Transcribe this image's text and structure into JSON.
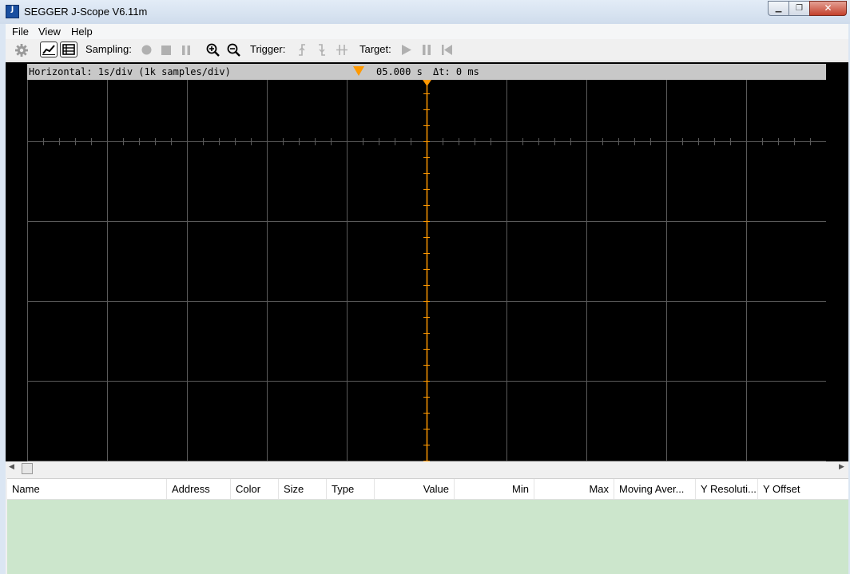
{
  "window": {
    "title": "SEGGER J-Scope V6.11m",
    "icon_label": "J",
    "icon_sublabel": "Scope",
    "controls": [
      "minimize-icon",
      "maximize-icon",
      "close-icon"
    ]
  },
  "menu": {
    "items": [
      "File",
      "View",
      "Help"
    ]
  },
  "toolbar": {
    "sampling_label": "Sampling:",
    "trigger_label": "Trigger:",
    "target_label": "Target:",
    "icons": [
      "gear-icon",
      "chart-view-icon",
      "table-view-icon",
      "record-icon",
      "stop-icon",
      "pause-icon",
      "zoom-in-icon",
      "zoom-out-icon",
      "trigger-rising-icon",
      "trigger-falling-icon",
      "trigger-both-icon",
      "play-icon",
      "pause-icon",
      "restart-icon"
    ]
  },
  "scope": {
    "horizontal_label": "Horizontal: 1s/div (1k samples/div)",
    "time_position": "05.000 s",
    "delta_label": "Δt: 0 ms",
    "cursor_color": "#ff9900",
    "grid_color": "#5a5a5a"
  },
  "table": {
    "columns": [
      "Name",
      "Address",
      "Color",
      "Size",
      "Type",
      "Value",
      "Min",
      "Max",
      "Moving Aver...",
      "Y Resoluti...",
      "Y Offset"
    ],
    "background_color": "#cce6cc"
  }
}
